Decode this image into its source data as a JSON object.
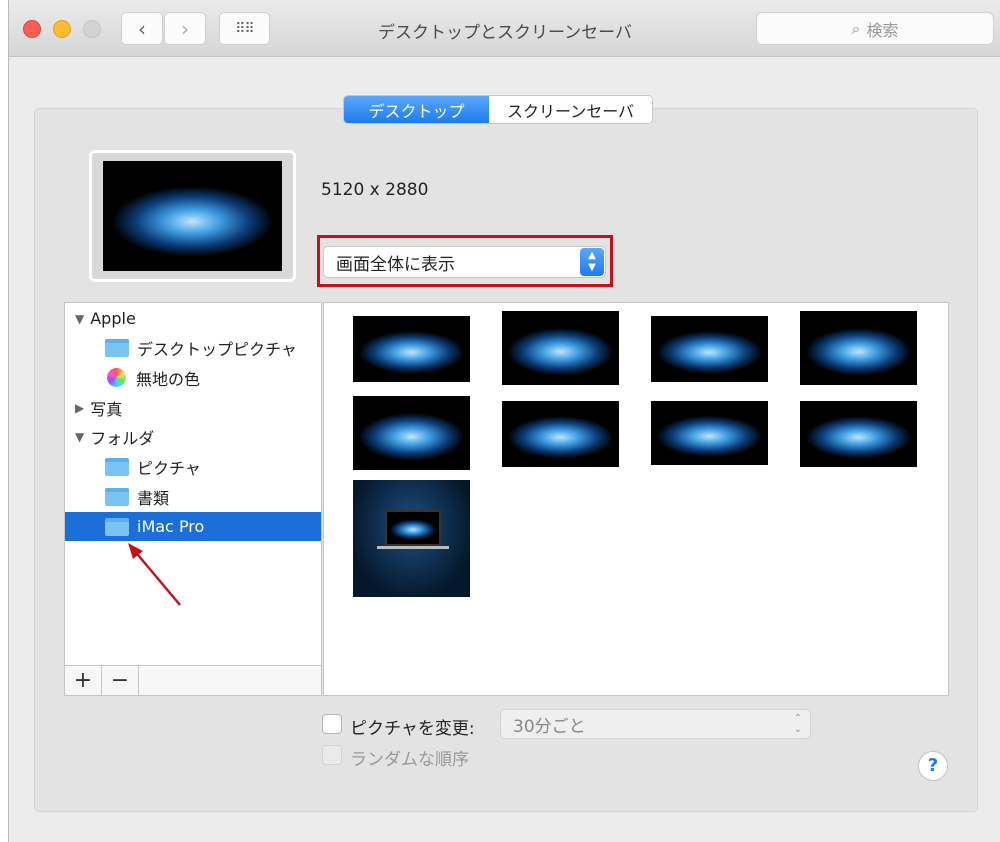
{
  "window": {
    "title": "デスクトップとスクリーンセーバ",
    "search_placeholder": "検索"
  },
  "tabs": [
    {
      "label": "デスクトップ",
      "active": true
    },
    {
      "label": "スクリーンセーバ",
      "active": false
    }
  ],
  "preview": {
    "resolution": "5120 x 2880"
  },
  "fit_select": {
    "value": "画面全体に表示"
  },
  "sidebar": {
    "items": [
      {
        "label": "Apple",
        "type": "group",
        "expanded": true
      },
      {
        "label": "デスクトップピクチャ",
        "type": "folder"
      },
      {
        "label": "無地の色",
        "type": "color"
      },
      {
        "label": "写真",
        "type": "group",
        "expanded": false
      },
      {
        "label": "フォルダ",
        "type": "group",
        "expanded": true
      },
      {
        "label": "ピクチャ",
        "type": "folder"
      },
      {
        "label": "書類",
        "type": "folder"
      },
      {
        "label": "iMac Pro",
        "type": "folder",
        "selected": true
      }
    ],
    "add": "+",
    "remove": "−"
  },
  "options": {
    "change_picture_label": "ピクチャを変更:",
    "interval": "30分ごと",
    "random_label": "ランダムな順序",
    "help": "?"
  },
  "colors": {
    "accent": "#1d7cf2",
    "annotation": "#c4121c"
  }
}
